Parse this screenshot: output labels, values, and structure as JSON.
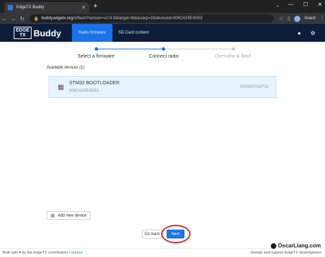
{
  "browser": {
    "tab_title": "EdgeTX Buddy",
    "url_domain": "buddy.edgetx.org",
    "url_path": "/#/flash?version=v2.8.0&target=tlite&step=2&deviceId=006C625E4D53",
    "profile_label": "Guest"
  },
  "app": {
    "logo_line1": "EDGE",
    "logo_line2": "TX",
    "logo_text": "Buddy",
    "nav_tabs": [
      {
        "label": "Radio firmware"
      },
      {
        "label": "SD Card content"
      }
    ]
  },
  "stepper": {
    "steps": [
      {
        "label": "Select a firmware",
        "state": "done"
      },
      {
        "label": "Connect radio",
        "state": "active"
      },
      {
        "label": "Overview & flash",
        "state": "pending"
      }
    ],
    "colors": {
      "active": "#1a73e8",
      "pending": "#cfcfcf"
    }
  },
  "devices": {
    "heading": "Available devices (1)",
    "items": [
      {
        "name": "STM32 BOOTLOADER",
        "serial": "006C625E4D53",
        "vid_pid": "0x0483:0xDF11"
      }
    ]
  },
  "actions": {
    "add_device": "Add new device",
    "go_back": "Go back",
    "next": "Next"
  },
  "footer": {
    "built_prefix": "Built with",
    "built_suffix": "by the EdgeTX contributors",
    "source_link": "source",
    "donate": "Donate and support EdgeTX development"
  },
  "watermark": "OscarLiang.com"
}
